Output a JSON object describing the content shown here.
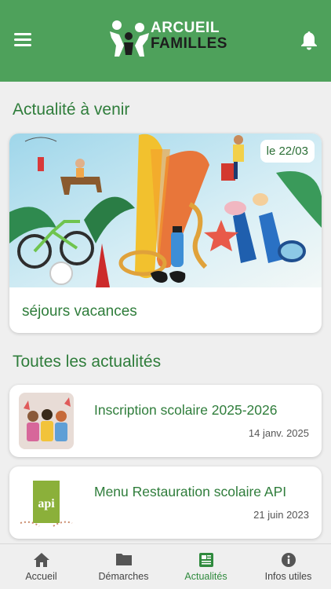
{
  "header": {
    "logo_line1": "ARCUEIL",
    "logo_line2": "FAMILLES",
    "menu_icon": "hamburger-icon",
    "bell_icon": "bell-icon",
    "color": "#4ea15b"
  },
  "upcoming": {
    "title": "Actualité à venir",
    "card": {
      "date": "le 22/03",
      "title": "séjours vacances"
    }
  },
  "all_news": {
    "title": "Toutes les actualités",
    "items": [
      {
        "title": "Inscription scolaire 2025-2026",
        "date": "14 janv. 2025"
      },
      {
        "title": "Menu Restauration scolaire API",
        "date": "21 juin 2023"
      }
    ]
  },
  "tabs": [
    {
      "label": "Accueil",
      "icon": "home-icon",
      "active": false
    },
    {
      "label": "Démarches",
      "icon": "folder-icon",
      "active": false
    },
    {
      "label": "Actualités",
      "icon": "newspaper-icon",
      "active": true
    },
    {
      "label": "Infos utiles",
      "icon": "info-icon",
      "active": false
    }
  ],
  "colors": {
    "accent": "#2f7d3b",
    "active_tab": "#2f8a3d"
  }
}
